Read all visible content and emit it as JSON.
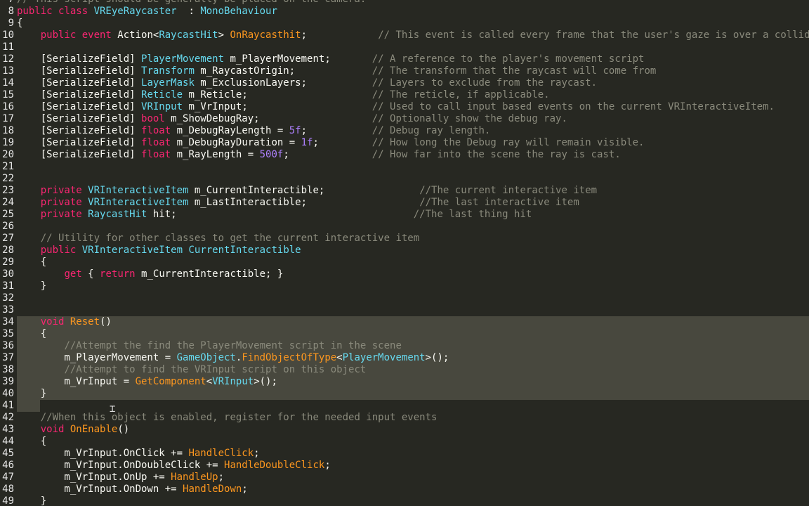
{
  "palette": {
    "background": "#272822",
    "selection": "#48483e",
    "comment": "#8a8a7c",
    "keyword": "#f92672",
    "type": "#66d9ef",
    "function": "#fd971f",
    "number": "#ae81ff"
  },
  "cursor": {
    "icon": "text-ibeam-cursor-icon"
  },
  "lines": [
    {
      "num": "7",
      "sel": "",
      "tokens": [
        [
          "cmt",
          "// This script should be generally be placed on the camera."
        ]
      ]
    },
    {
      "num": "8",
      "sel": "",
      "tokens": [
        [
          "kw",
          "public class "
        ],
        [
          "typ",
          "VREyeRaycaster"
        ],
        [
          "",
          "  : "
        ],
        [
          "typ",
          "MonoBehaviour"
        ]
      ]
    },
    {
      "num": "9",
      "sel": "",
      "tokens": [
        [
          "",
          "{"
        ]
      ]
    },
    {
      "num": "10",
      "sel": "",
      "tokens": [
        [
          "",
          "    "
        ],
        [
          "kw",
          "public event "
        ],
        [
          "",
          "Action<"
        ],
        [
          "typ",
          "RaycastHit"
        ],
        [
          "",
          "> "
        ],
        [
          "fn",
          "OnRaycasthit"
        ],
        [
          "",
          ";            "
        ],
        [
          "cmt",
          "// This event is called every frame that the user's gaze is over a collider."
        ]
      ]
    },
    {
      "num": "11",
      "sel": "",
      "tokens": []
    },
    {
      "num": "12",
      "sel": "",
      "tokens": [
        [
          "",
          "    [SerializeField] "
        ],
        [
          "typ",
          "PlayerMovement"
        ],
        [
          "",
          " m_PlayerMovement;       "
        ],
        [
          "cmt",
          "// A reference to the player's movement script"
        ]
      ]
    },
    {
      "num": "13",
      "sel": "",
      "tokens": [
        [
          "",
          "    [SerializeField] "
        ],
        [
          "typ",
          "Transform"
        ],
        [
          "",
          " m_RaycastOrigin;             "
        ],
        [
          "cmt",
          "// The transform that the raycast will come from"
        ]
      ]
    },
    {
      "num": "14",
      "sel": "",
      "tokens": [
        [
          "",
          "    [SerializeField] "
        ],
        [
          "typ",
          "LayerMask"
        ],
        [
          "",
          " m_ExclusionLayers;           "
        ],
        [
          "cmt",
          "// Layers to exclude from the raycast."
        ]
      ]
    },
    {
      "num": "15",
      "sel": "",
      "tokens": [
        [
          "",
          "    [SerializeField] "
        ],
        [
          "typ",
          "Reticle"
        ],
        [
          "",
          " m_Reticle;                     "
        ],
        [
          "cmt",
          "// The reticle, if applicable."
        ]
      ]
    },
    {
      "num": "16",
      "sel": "",
      "tokens": [
        [
          "",
          "    [SerializeField] "
        ],
        [
          "typ",
          "VRInput"
        ],
        [
          "",
          " m_VrInput;                     "
        ],
        [
          "cmt",
          "// Used to call input based events on the current VRInteractiveItem."
        ]
      ]
    },
    {
      "num": "17",
      "sel": "",
      "tokens": [
        [
          "",
          "    [SerializeField] "
        ],
        [
          "kw",
          "bool"
        ],
        [
          "",
          " m_ShowDebugRay;                   "
        ],
        [
          "cmt",
          "// Optionally show the debug ray."
        ]
      ]
    },
    {
      "num": "18",
      "sel": "",
      "tokens": [
        [
          "",
          "    [SerializeField] "
        ],
        [
          "kw",
          "float"
        ],
        [
          "",
          " m_DebugRayLength = "
        ],
        [
          "num",
          "5f"
        ],
        [
          "",
          ";           "
        ],
        [
          "cmt",
          "// Debug ray length."
        ]
      ]
    },
    {
      "num": "19",
      "sel": "",
      "tokens": [
        [
          "",
          "    [SerializeField] "
        ],
        [
          "kw",
          "float"
        ],
        [
          "",
          " m_DebugRayDuration = "
        ],
        [
          "num",
          "1f"
        ],
        [
          "",
          ";         "
        ],
        [
          "cmt",
          "// How long the Debug ray will remain visible."
        ]
      ]
    },
    {
      "num": "20",
      "sel": "",
      "tokens": [
        [
          "",
          "    [SerializeField] "
        ],
        [
          "kw",
          "float"
        ],
        [
          "",
          " m_RayLength = "
        ],
        [
          "num",
          "500f"
        ],
        [
          "",
          ";              "
        ],
        [
          "cmt",
          "// How far into the scene the ray is cast."
        ]
      ]
    },
    {
      "num": "21",
      "sel": "",
      "tokens": []
    },
    {
      "num": "22",
      "sel": "",
      "tokens": []
    },
    {
      "num": "23",
      "sel": "",
      "tokens": [
        [
          "",
          "    "
        ],
        [
          "kw",
          "private "
        ],
        [
          "typ",
          "VRInteractiveItem"
        ],
        [
          "",
          " m_CurrentInteractible;                "
        ],
        [
          "cmt",
          "//The current interactive item"
        ]
      ]
    },
    {
      "num": "24",
      "sel": "",
      "tokens": [
        [
          "",
          "    "
        ],
        [
          "kw",
          "private "
        ],
        [
          "typ",
          "VRInteractiveItem"
        ],
        [
          "",
          " m_LastInteractible;                   "
        ],
        [
          "cmt",
          "//The last interactive item"
        ]
      ]
    },
    {
      "num": "25",
      "sel": "",
      "tokens": [
        [
          "",
          "    "
        ],
        [
          "kw",
          "private "
        ],
        [
          "typ",
          "RaycastHit"
        ],
        [
          "",
          " hit;                                        "
        ],
        [
          "cmt",
          "//The last thing hit"
        ]
      ]
    },
    {
      "num": "26",
      "sel": "",
      "tokens": []
    },
    {
      "num": "27",
      "sel": "",
      "tokens": [
        [
          "",
          "    "
        ],
        [
          "cmt",
          "// Utility for other classes to get the current interactive item"
        ]
      ]
    },
    {
      "num": "28",
      "sel": "",
      "tokens": [
        [
          "",
          "    "
        ],
        [
          "kw",
          "public "
        ],
        [
          "typ",
          "VRInteractiveItem"
        ],
        [
          "",
          " "
        ],
        [
          "typ",
          "CurrentInteractible"
        ]
      ]
    },
    {
      "num": "29",
      "sel": "",
      "tokens": [
        [
          "",
          "    {"
        ]
      ]
    },
    {
      "num": "30",
      "sel": "",
      "tokens": [
        [
          "",
          "        "
        ],
        [
          "kw",
          "get"
        ],
        [
          "",
          " { "
        ],
        [
          "kw",
          "return"
        ],
        [
          "",
          " m_CurrentInteractible; }"
        ]
      ]
    },
    {
      "num": "31",
      "sel": "",
      "tokens": [
        [
          "",
          "    }"
        ]
      ]
    },
    {
      "num": "32",
      "sel": "",
      "tokens": []
    },
    {
      "num": "33",
      "sel": "",
      "tokens": []
    },
    {
      "num": "34",
      "sel": "full",
      "tokens": [
        [
          "",
          "    "
        ],
        [
          "kw",
          "void"
        ],
        [
          "",
          " "
        ],
        [
          "fn",
          "Reset"
        ],
        [
          "",
          "()"
        ]
      ]
    },
    {
      "num": "35",
      "sel": "full",
      "tokens": [
        [
          "",
          "    {"
        ]
      ]
    },
    {
      "num": "36",
      "sel": "full",
      "tokens": [
        [
          "",
          "        "
        ],
        [
          "cmt",
          "//Attempt the find the PlayerMovement script in the scene"
        ]
      ]
    },
    {
      "num": "37",
      "sel": "full",
      "tokens": [
        [
          "",
          "        m_PlayerMovement = "
        ],
        [
          "typ",
          "GameObject"
        ],
        [
          "",
          "."
        ],
        [
          "fn",
          "FindObjectOfType"
        ],
        [
          "",
          "<"
        ],
        [
          "typ",
          "PlayerMovement"
        ],
        [
          "",
          ">();"
        ]
      ]
    },
    {
      "num": "38",
      "sel": "full",
      "tokens": [
        [
          "",
          "        "
        ],
        [
          "cmt",
          "//Attempt to find the VRInput script on this object"
        ]
      ]
    },
    {
      "num": "39",
      "sel": "full",
      "tokens": [
        [
          "",
          "        m_VrInput = "
        ],
        [
          "fn",
          "GetComponent"
        ],
        [
          "",
          "<"
        ],
        [
          "typ",
          "VRInput"
        ],
        [
          "",
          ">();"
        ]
      ]
    },
    {
      "num": "40",
      "sel": "full",
      "tokens": [
        [
          "",
          "    }"
        ]
      ]
    },
    {
      "num": "41",
      "sel": "partial",
      "tokens": []
    },
    {
      "num": "42",
      "sel": "",
      "tokens": [
        [
          "",
          "    "
        ],
        [
          "cmt",
          "//When this object is enabled, register for the needed input events"
        ]
      ]
    },
    {
      "num": "43",
      "sel": "",
      "tokens": [
        [
          "",
          "    "
        ],
        [
          "kw",
          "void"
        ],
        [
          "",
          " "
        ],
        [
          "fn",
          "OnEnable"
        ],
        [
          "",
          "()"
        ]
      ]
    },
    {
      "num": "44",
      "sel": "",
      "tokens": [
        [
          "",
          "    {"
        ]
      ]
    },
    {
      "num": "45",
      "sel": "",
      "tokens": [
        [
          "",
          "        m_VrInput.OnClick += "
        ],
        [
          "fn",
          "HandleClick"
        ],
        [
          "",
          ";"
        ]
      ]
    },
    {
      "num": "46",
      "sel": "",
      "tokens": [
        [
          "",
          "        m_VrInput.OnDoubleClick += "
        ],
        [
          "fn",
          "HandleDoubleClick"
        ],
        [
          "",
          ";"
        ]
      ]
    },
    {
      "num": "47",
      "sel": "",
      "tokens": [
        [
          "",
          "        m_VrInput.OnUp += "
        ],
        [
          "fn",
          "HandleUp"
        ],
        [
          "",
          ";"
        ]
      ]
    },
    {
      "num": "48",
      "sel": "",
      "tokens": [
        [
          "",
          "        m_VrInput.OnDown += "
        ],
        [
          "fn",
          "HandleDown"
        ],
        [
          "",
          ";"
        ]
      ]
    },
    {
      "num": "49",
      "sel": "",
      "tokens": [
        [
          "",
          "    }"
        ]
      ]
    }
  ]
}
